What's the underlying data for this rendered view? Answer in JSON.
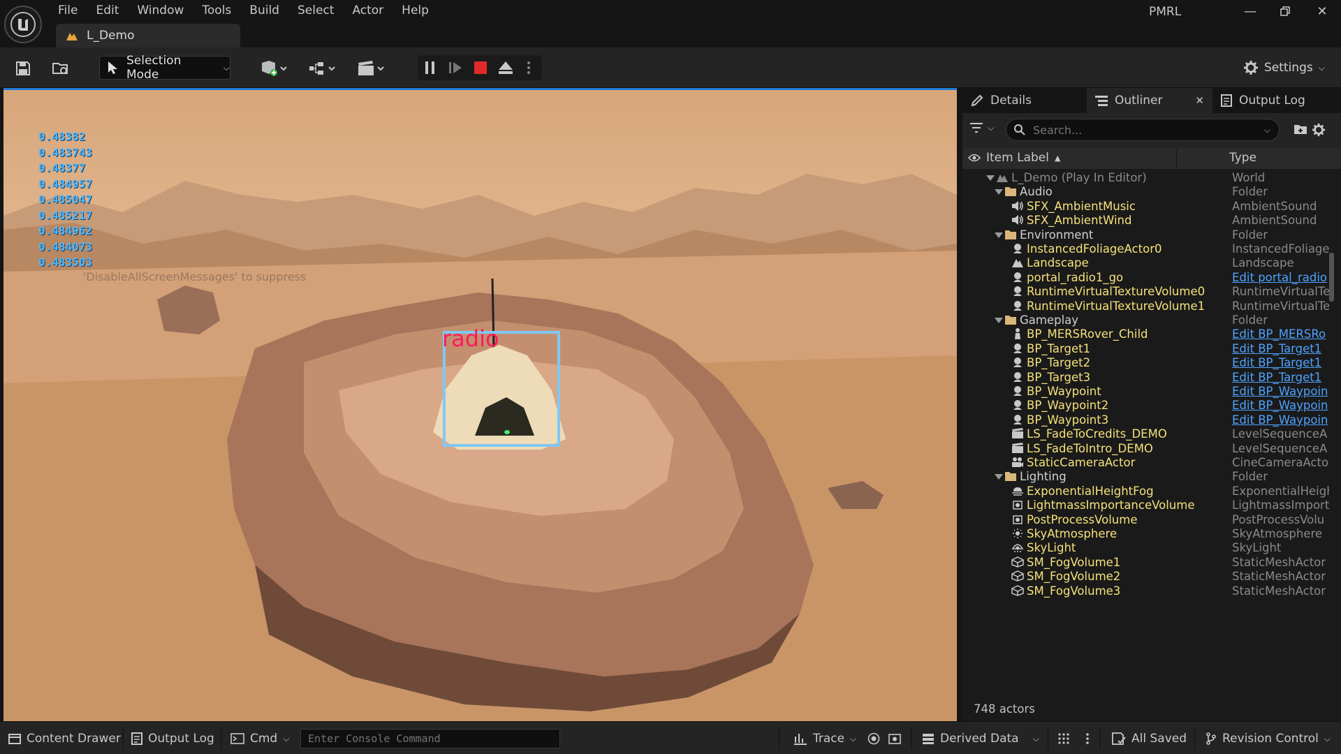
{
  "menu": [
    "File",
    "Edit",
    "Window",
    "Tools",
    "Build",
    "Select",
    "Actor",
    "Help"
  ],
  "map_tab": "L_Demo",
  "project_name": "PMRL",
  "toolbar": {
    "selection_mode": "Selection Mode",
    "settings": "Settings"
  },
  "viewport": {
    "stats": [
      "0.48382",
      "0.483743",
      "0.48377",
      "0.484957",
      "0.485047",
      "0.485217",
      "0.484962",
      "0.484073",
      "0.483503"
    ],
    "suppress_message": "'DisableAllScreenMessages' to suppress",
    "detection_label": "radio",
    "colors": {
      "bbox": "#7fc8f5",
      "label": "#ff1a5a",
      "stats": "#4fb8ff"
    }
  },
  "panel": {
    "tabs": [
      "Details",
      "Outliner",
      "Output Log"
    ],
    "search_placeholder": "Search...",
    "col_label": "Item Label",
    "col_type": "Type",
    "rows": [
      {
        "label": "L_Demo (Play In Editor)",
        "type": "World",
        "depth": 0,
        "expand": true,
        "icon": "level-icon",
        "dim": true
      },
      {
        "label": "Audio",
        "type": "Folder",
        "depth": 1,
        "expand": true,
        "icon": "folder-icon"
      },
      {
        "label": "SFX_AmbientMusic",
        "type": "AmbientSound",
        "depth": 2,
        "icon": "speaker-icon"
      },
      {
        "label": "SFX_AmbientWind",
        "type": "AmbientSound",
        "depth": 2,
        "icon": "speaker-icon"
      },
      {
        "label": "Environment",
        "type": "Folder",
        "depth": 1,
        "expand": true,
        "icon": "folder-icon"
      },
      {
        "label": "InstancedFoliageActor0",
        "type": "InstancedFoliage",
        "depth": 2,
        "icon": "actor-icon"
      },
      {
        "label": "Landscape",
        "type": "Landscape",
        "depth": 2,
        "icon": "landscape-icon"
      },
      {
        "label": "portal_radio1_go",
        "type": "Edit portal_radio",
        "depth": 2,
        "icon": "actor-icon",
        "link": true
      },
      {
        "label": "RuntimeVirtualTextureVolume0",
        "type": "RuntimeVirtualTe",
        "depth": 2,
        "icon": "actor-icon"
      },
      {
        "label": "RuntimeVirtualTextureVolume1",
        "type": "RuntimeVirtualTe",
        "depth": 2,
        "icon": "actor-icon"
      },
      {
        "label": "Gameplay",
        "type": "Folder",
        "depth": 1,
        "expand": true,
        "icon": "folder-icon"
      },
      {
        "label": "BP_MERSRover_Child",
        "type": "Edit BP_MERSRo",
        "depth": 2,
        "icon": "pawn-icon",
        "link": true
      },
      {
        "label": "BP_Target1",
        "type": "Edit BP_Target1",
        "depth": 2,
        "icon": "actor-icon",
        "link": true
      },
      {
        "label": "BP_Target2",
        "type": "Edit BP_Target1",
        "depth": 2,
        "icon": "actor-icon",
        "link": true
      },
      {
        "label": "BP_Target3",
        "type": "Edit BP_Target1",
        "depth": 2,
        "icon": "actor-icon",
        "link": true
      },
      {
        "label": "BP_Waypoint",
        "type": "Edit BP_Waypoin",
        "depth": 2,
        "icon": "actor-icon",
        "link": true
      },
      {
        "label": "BP_Waypoint2",
        "type": "Edit BP_Waypoin",
        "depth": 2,
        "icon": "actor-icon",
        "link": true
      },
      {
        "label": "BP_Waypoint3",
        "type": "Edit BP_Waypoin",
        "depth": 2,
        "icon": "actor-icon",
        "link": true
      },
      {
        "label": "LS_FadeToCredits_DEMO",
        "type": "LevelSequenceA",
        "depth": 2,
        "icon": "sequence-icon"
      },
      {
        "label": "LS_FadeToIntro_DEMO",
        "type": "LevelSequenceA",
        "depth": 2,
        "icon": "sequence-icon"
      },
      {
        "label": "StaticCameraActor",
        "type": "CineCameraActo",
        "depth": 2,
        "icon": "camera-icon"
      },
      {
        "label": "Lighting",
        "type": "Folder",
        "depth": 1,
        "expand": true,
        "icon": "folder-icon"
      },
      {
        "label": "ExponentialHeightFog",
        "type": "ExponentialHeigh",
        "depth": 2,
        "icon": "fog-icon"
      },
      {
        "label": "LightmassImportanceVolume",
        "type": "LightmassImport",
        "depth": 2,
        "icon": "volume-icon"
      },
      {
        "label": "PostProcessVolume",
        "type": "PostProcessVolu",
        "depth": 2,
        "icon": "volume-icon"
      },
      {
        "label": "SkyAtmosphere",
        "type": "SkyAtmosphere",
        "depth": 2,
        "icon": "sun-icon"
      },
      {
        "label": "SkyLight",
        "type": "SkyLight",
        "depth": 2,
        "icon": "skylight-icon"
      },
      {
        "label": "SM_FogVolume1",
        "type": "StaticMeshActor",
        "depth": 2,
        "icon": "mesh-icon"
      },
      {
        "label": "SM_FogVolume2",
        "type": "StaticMeshActor",
        "depth": 2,
        "icon": "mesh-icon"
      },
      {
        "label": "SM_FogVolume3",
        "type": "StaticMeshActor",
        "depth": 2,
        "icon": "mesh-icon"
      }
    ],
    "actor_count": "748 actors"
  },
  "bottom": {
    "content_drawer": "Content Drawer",
    "output_log": "Output Log",
    "cmd": "Cmd",
    "console_placeholder": "Enter Console Command",
    "trace": "Trace",
    "derived_data": "Derived Data",
    "all_saved": "All Saved",
    "revision_control": "Revision Control"
  },
  "colors": {
    "label_text": "#f5e17a",
    "link": "#4ea3ff",
    "accent": "#1f7bd6",
    "stop": "#e02a2a"
  }
}
